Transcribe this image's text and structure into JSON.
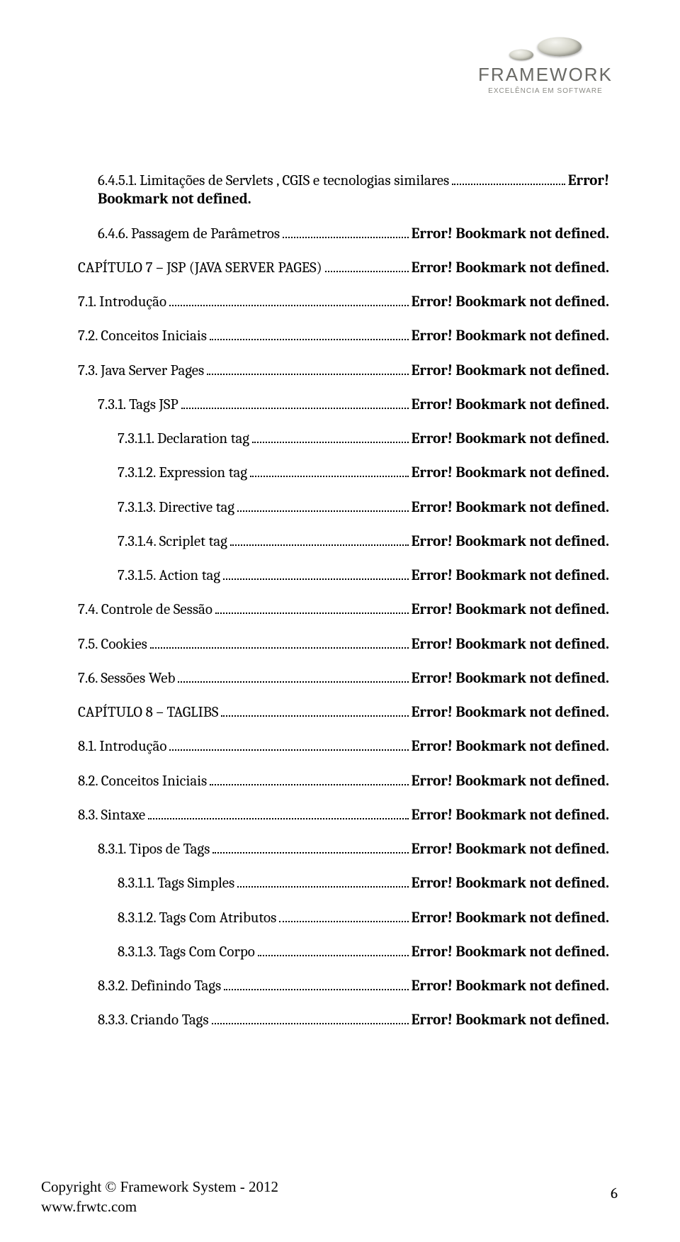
{
  "logo": {
    "brand": "FRAMEWORK",
    "tagline": "EXCELÊNCIA EM SOFTWARE"
  },
  "error": "Error! Bookmark not defined.",
  "error_short": "Error!",
  "bookmark_line": "Bookmark not defined.",
  "toc": [
    {
      "indent": 1,
      "label": "6.4.5.1. Limitações de Servlets , CGIS e tecnologias similares",
      "wrap": true
    },
    {
      "indent": 1,
      "label": "6.4.6. Passagem de Parâmetros"
    },
    {
      "indent": 0,
      "label": "CAPÍTULO 7 – JSP (JAVA SERVER PAGES)"
    },
    {
      "indent": 0,
      "label": "7.1. Introdução"
    },
    {
      "indent": 0,
      "label": "7.2. Conceitos Iniciais"
    },
    {
      "indent": 0,
      "label": "7.3. Java Server Pages"
    },
    {
      "indent": 1,
      "label": "7.3.1. Tags JSP"
    },
    {
      "indent": 2,
      "label": "7.3.1.1. Declaration tag"
    },
    {
      "indent": 2,
      "label": "7.3.1.2. Expression tag"
    },
    {
      "indent": 2,
      "label": "7.3.1.3. Directive tag"
    },
    {
      "indent": 2,
      "label": "7.3.1.4. Scriplet tag"
    },
    {
      "indent": 2,
      "label": "7.3.1.5. Action tag"
    },
    {
      "indent": 0,
      "label": "7.4. Controle de Sessão"
    },
    {
      "indent": 0,
      "label": "7.5. Cookies"
    },
    {
      "indent": 0,
      "label": "7.6. Sessões Web"
    },
    {
      "indent": 0,
      "label": "CAPÍTULO 8 – TAGLIBS"
    },
    {
      "indent": 0,
      "label": "8.1. Introdução"
    },
    {
      "indent": 0,
      "label": "8.2. Conceitos Iniciais"
    },
    {
      "indent": 0,
      "label": "8.3. Sintaxe"
    },
    {
      "indent": 1,
      "label": "8.3.1. Tipos de Tags"
    },
    {
      "indent": 2,
      "label": "8.3.1.1. Tags Simples"
    },
    {
      "indent": 2,
      "label": "8.3.1.2. Tags Com Atributos"
    },
    {
      "indent": 2,
      "label": "8.3.1.3. Tags Com Corpo"
    },
    {
      "indent": 1,
      "label": "8.3.2. Definindo Tags"
    },
    {
      "indent": 1,
      "label": "8.3.3. Criando Tags"
    }
  ],
  "footer": {
    "copyright": "Copyright © Framework System - 2012",
    "url": "www.frwtc.com",
    "page": "6"
  }
}
